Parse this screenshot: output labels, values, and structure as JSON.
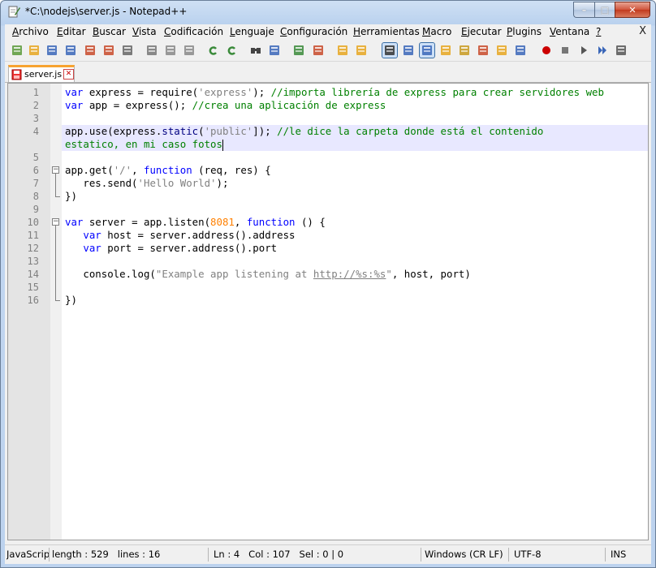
{
  "window": {
    "title": "*C:\\nodejs\\server.js - Notepad++",
    "min_glyph": "–",
    "max_glyph": "□",
    "close_glyph": "✕"
  },
  "menu": {
    "items": [
      {
        "label": "Archivo"
      },
      {
        "label": "Editar"
      },
      {
        "label": "Buscar"
      },
      {
        "label": "Vista"
      },
      {
        "label": "Codificación"
      },
      {
        "label": "Lenguaje"
      },
      {
        "label": "Configuración"
      },
      {
        "label": "Herramientas"
      },
      {
        "label": "Macro"
      },
      {
        "label": "Ejecutar"
      },
      {
        "label": "Plugins"
      },
      {
        "label": "Ventana"
      },
      {
        "label": "?"
      }
    ],
    "close_label": "X"
  },
  "toolbar": {
    "icons": [
      "new-file-icon",
      "open-file-icon",
      "save-icon",
      "save-all-icon",
      "close-icon",
      "close-all-icon",
      "print-icon",
      "cut-icon",
      "copy-icon",
      "paste-icon",
      "undo-icon",
      "redo-icon",
      "find-icon",
      "replace-icon",
      "zoom-in-icon",
      "zoom-out-icon",
      "sync-vertical-icon",
      "sync-horizontal-icon",
      "word-wrap-icon",
      "show-all-chars-icon",
      "indent-guide-icon",
      "user-language-icon",
      "document-map-icon",
      "function-list-icon",
      "folder-workspace-icon",
      "monitor-icon",
      "record-macro-icon",
      "stop-record-icon",
      "play-macro-icon",
      "run-macro-multiple-icon",
      "save-macro-icon"
    ]
  },
  "tabs": [
    {
      "label": "server.js",
      "close_glyph": "✕"
    }
  ],
  "editor": {
    "lines": [
      {
        "n": "1",
        "tokens": [
          [
            "kw",
            "var"
          ],
          [
            "id",
            " express = require("
          ],
          [
            "str",
            "'express'"
          ],
          [
            "id",
            "); "
          ],
          [
            "cm",
            "//importa librería de express para crear servidores web"
          ]
        ]
      },
      {
        "n": "2",
        "tokens": [
          [
            "kw",
            "var"
          ],
          [
            "id",
            " app = express(); "
          ],
          [
            "cm",
            "//crea una aplicación de express"
          ]
        ]
      },
      {
        "n": "3",
        "tokens": []
      },
      {
        "n": "4",
        "tokens": [
          [
            "id",
            "app.use(express."
          ],
          [
            "fn",
            "static"
          ],
          [
            "id",
            "("
          ],
          [
            "str",
            "'public'"
          ],
          [
            "id",
            "]); "
          ],
          [
            "cm",
            "//le dice la carpeta donde está el contenido"
          ]
        ]
      },
      {
        "n": "",
        "tokens": [
          [
            "cm",
            "estatico, en mi caso fotos"
          ]
        ]
      },
      {
        "n": "5",
        "tokens": []
      },
      {
        "n": "6",
        "tokens": [
          [
            "id",
            "app.get("
          ],
          [
            "str",
            "'/'"
          ],
          [
            "id",
            ", "
          ],
          [
            "kw",
            "function"
          ],
          [
            "id",
            " (req, res) {"
          ]
        ]
      },
      {
        "n": "7",
        "tokens": [
          [
            "id",
            "   res.send("
          ],
          [
            "str",
            "'Hello World'"
          ],
          [
            "id",
            ");"
          ]
        ]
      },
      {
        "n": "8",
        "tokens": [
          [
            "id",
            "})"
          ]
        ]
      },
      {
        "n": "9",
        "tokens": []
      },
      {
        "n": "10",
        "tokens": [
          [
            "kw",
            "var"
          ],
          [
            "id",
            " server = app.listen("
          ],
          [
            "num",
            "8081"
          ],
          [
            "id",
            ", "
          ],
          [
            "kw",
            "function"
          ],
          [
            "id",
            " () {"
          ]
        ]
      },
      {
        "n": "11",
        "tokens": [
          [
            "id",
            "   "
          ],
          [
            "kw",
            "var"
          ],
          [
            "id",
            " host = server.address().address"
          ]
        ]
      },
      {
        "n": "12",
        "tokens": [
          [
            "id",
            "   "
          ],
          [
            "kw",
            "var"
          ],
          [
            "id",
            " port = server.address().port"
          ]
        ]
      },
      {
        "n": "13",
        "tokens": []
      },
      {
        "n": "14",
        "tokens": [
          [
            "id",
            "   console.log("
          ],
          [
            "str",
            "\"Example app listening at "
          ],
          [
            "url",
            "http://%s:%s"
          ],
          [
            "str",
            "\""
          ],
          [
            "id",
            ", host, port)"
          ]
        ]
      },
      {
        "n": "15",
        "tokens": []
      },
      {
        "n": "16",
        "tokens": [
          [
            "id",
            "})"
          ]
        ]
      }
    ]
  },
  "status": {
    "language": "JavaScript",
    "length": "length : 529",
    "lines": "lines : 16",
    "ln": "Ln : 4",
    "col": "Col : 107",
    "sel": "Sel : 0 | 0",
    "eol": "Windows (CR LF)",
    "encoding": "UTF-8",
    "mode": "INS"
  }
}
